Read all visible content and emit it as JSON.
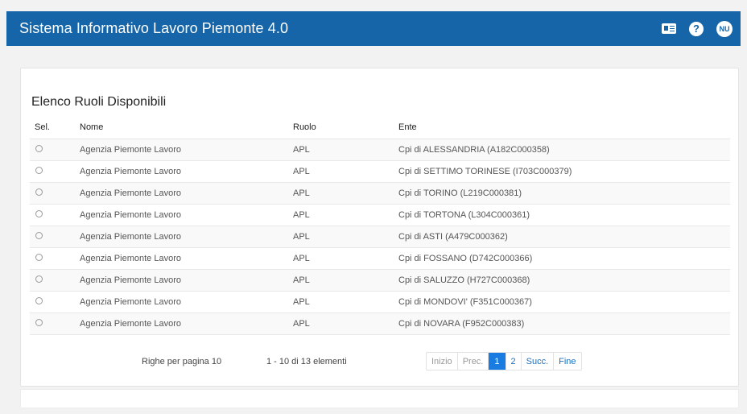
{
  "header": {
    "title": "Sistema Informativo Lavoro Piemonte 4.0",
    "user_initials": "NU",
    "help_glyph": "?",
    "icons": [
      "id-card-icon",
      "help-icon",
      "user-avatar"
    ]
  },
  "panel": {
    "title": "Elenco Ruoli Disponibili",
    "columns": [
      "Sel.",
      "Nome",
      "Ruolo",
      "Ente"
    ],
    "rows": [
      {
        "nome": "Agenzia Piemonte Lavoro",
        "ruolo": "APL",
        "ente": "Cpi di ALESSANDRIA (A182C000358)"
      },
      {
        "nome": "Agenzia Piemonte Lavoro",
        "ruolo": "APL",
        "ente": "Cpi di SETTIMO TORINESE (I703C000379)"
      },
      {
        "nome": "Agenzia Piemonte Lavoro",
        "ruolo": "APL",
        "ente": "Cpi di TORINO (L219C000381)"
      },
      {
        "nome": "Agenzia Piemonte Lavoro",
        "ruolo": "APL",
        "ente": "Cpi di TORTONA (L304C000361)"
      },
      {
        "nome": "Agenzia Piemonte Lavoro",
        "ruolo": "APL",
        "ente": "Cpi di ASTI (A479C000362)"
      },
      {
        "nome": "Agenzia Piemonte Lavoro",
        "ruolo": "APL",
        "ente": "Cpi di FOSSANO (D742C000366)"
      },
      {
        "nome": "Agenzia Piemonte Lavoro",
        "ruolo": "APL",
        "ente": "Cpi di SALUZZO (H727C000368)"
      },
      {
        "nome": "Agenzia Piemonte Lavoro",
        "ruolo": "APL",
        "ente": "Cpi di MONDOVI' (F351C000367)"
      },
      {
        "nome": "Agenzia Piemonte Lavoro",
        "ruolo": "APL",
        "ente": "Cpi di NOVARA (F952C000383)"
      }
    ]
  },
  "footer": {
    "rows_per_page": "Righe per pagina 10",
    "range": "1 - 10 di 13 elementi",
    "pager": {
      "first": "Inizio",
      "prev": "Prec.",
      "pages": [
        "1",
        "2"
      ],
      "next": "Succ.",
      "last": "Fine"
    }
  },
  "colors": {
    "header_bg": "#1565a8",
    "active_page": "#1a7be0",
    "link": "#1a6fbf"
  }
}
